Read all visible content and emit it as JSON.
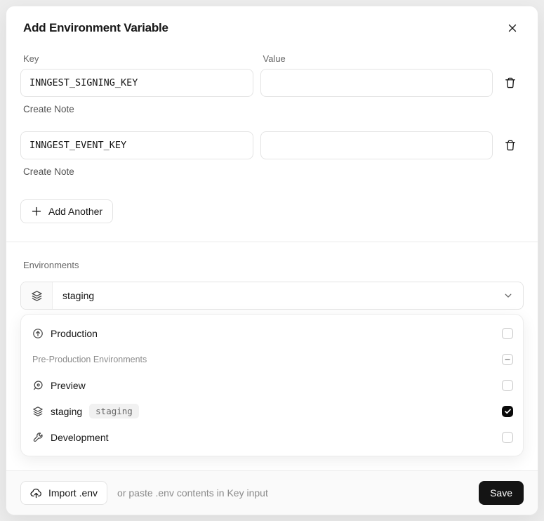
{
  "modal": {
    "title": "Add Environment Variable"
  },
  "form": {
    "key_label": "Key",
    "value_label": "Value",
    "rows": [
      {
        "key": "INNGEST_SIGNING_KEY",
        "value": "",
        "note_label": "Create Note"
      },
      {
        "key": "INNGEST_EVENT_KEY",
        "value": "",
        "note_label": "Create Note"
      }
    ],
    "add_another_label": "Add Another"
  },
  "environments": {
    "label": "Environments",
    "selected": "staging",
    "options": [
      {
        "label": "Production",
        "icon": "production-icon",
        "state": "unchecked"
      },
      {
        "label": "Pre-Production Environments",
        "icon": null,
        "state": "indeterminate"
      },
      {
        "label": "Preview",
        "icon": "preview-icon",
        "state": "unchecked"
      },
      {
        "label": "staging",
        "badge": "staging",
        "icon": "layers-icon",
        "state": "checked"
      },
      {
        "label": "Development",
        "icon": "wrench-icon",
        "state": "unchecked"
      }
    ]
  },
  "footer": {
    "import_label": "Import .env",
    "helper_text": "or paste .env contents in Key input",
    "save_label": "Save"
  },
  "colors": {
    "accent": "#141414",
    "border": "#e4e4e4",
    "muted_text": "#666666",
    "badge_bg": "#f1f1f1",
    "footer_bg": "#fafafa"
  }
}
